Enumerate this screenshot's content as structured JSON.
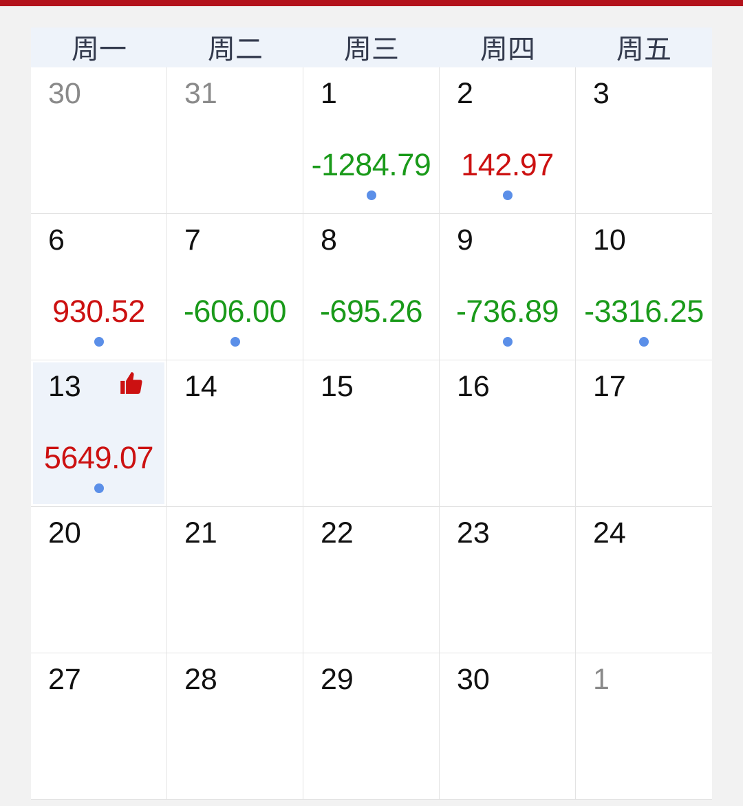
{
  "weekdays": [
    "周一",
    "周二",
    "周三",
    "周四",
    "周五"
  ],
  "colors": {
    "positive": "#cc1111",
    "negative": "#1a9a1a",
    "dot": "#5b8fe8",
    "accent": "#b3121b"
  },
  "days": [
    {
      "day": "30",
      "other": true
    },
    {
      "day": "31",
      "other": true
    },
    {
      "day": "1",
      "value": "-1284.79",
      "dot": true
    },
    {
      "day": "2",
      "value": "142.97",
      "dot": true
    },
    {
      "day": "3"
    },
    {
      "day": "6",
      "value": "930.52",
      "dot": true
    },
    {
      "day": "7",
      "value": "-606.00",
      "dot": true
    },
    {
      "day": "8",
      "value": "-695.26"
    },
    {
      "day": "9",
      "value": "-736.89",
      "dot": true
    },
    {
      "day": "10",
      "value": "-3316.25",
      "dot": true
    },
    {
      "day": "13",
      "value": "5649.07",
      "dot": true,
      "selected": true,
      "icon": "thumbs-up-icon"
    },
    {
      "day": "14"
    },
    {
      "day": "15"
    },
    {
      "day": "16"
    },
    {
      "day": "17"
    },
    {
      "day": "20"
    },
    {
      "day": "21"
    },
    {
      "day": "22"
    },
    {
      "day": "23"
    },
    {
      "day": "24"
    },
    {
      "day": "27"
    },
    {
      "day": "28"
    },
    {
      "day": "29"
    },
    {
      "day": "30"
    },
    {
      "day": "1",
      "other": true
    }
  ]
}
